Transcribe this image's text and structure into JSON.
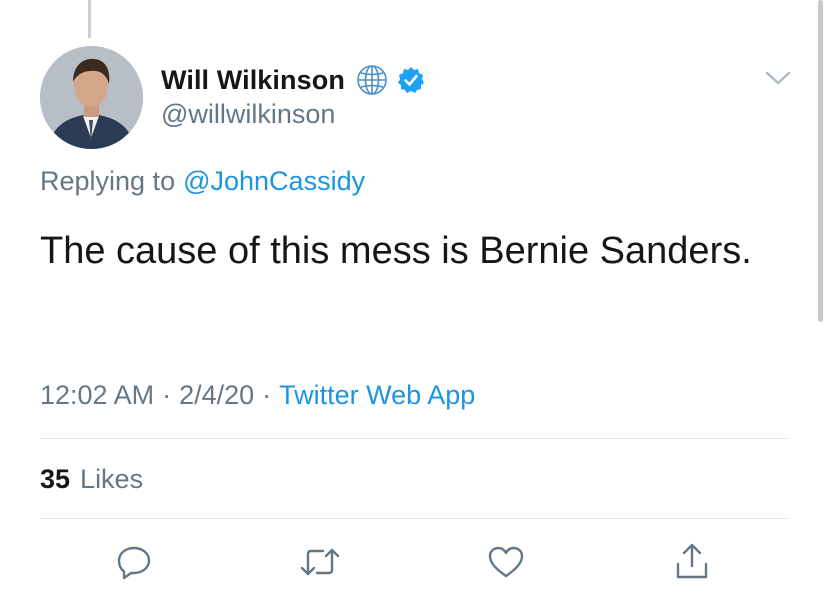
{
  "tweet": {
    "author": {
      "display_name": "Will Wilkinson",
      "handle": "@willwilkinson",
      "badges": [
        "globe-icon",
        "verified-icon"
      ]
    },
    "replying_to_prefix": "Replying to",
    "replying_to_handle": "@JohnCassidy",
    "text": "The cause of this mess is Bernie Sanders.",
    "time": "12:02 AM",
    "separator": "·",
    "date": "2/4/20",
    "source": "Twitter Web App",
    "likes_count": "35",
    "likes_label": "Likes"
  },
  "actions": [
    "reply-icon",
    "retweet-icon",
    "like-icon",
    "share-icon"
  ],
  "colors": {
    "text_primary": "#14171a",
    "text_secondary": "#657786",
    "link": "#1b95e0",
    "verified": "#1da1f2",
    "divider": "#dfe4e8"
  }
}
